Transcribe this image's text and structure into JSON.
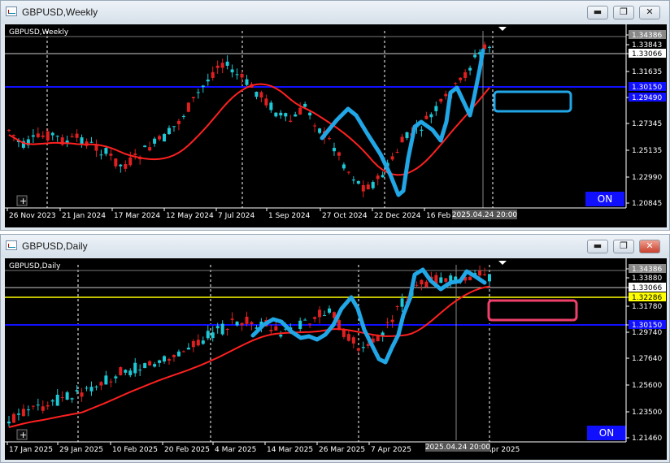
{
  "windows": [
    {
      "title": "GBPUSD,Weekly",
      "symbol_label": "GBPUSD,Weekly",
      "on_label": "ON",
      "cursor_time": "2025.04.24 20:00",
      "price_ticks": [
        "1.34386",
        "1.33843",
        "1.33066",
        "1.31635",
        "1.29490",
        "1.27345",
        "1.25135",
        "1.22990",
        "1.20845"
      ],
      "date_ticks": [
        "26 Nov 2023",
        "21 Jan 2024",
        "17 Mar 2024",
        "12 May 2024",
        "7 Jul 2024",
        "1 Sep 2024",
        "27 Oct 2024",
        "22 Dec 2024",
        "16 Feb"
      ],
      "hline_blue_label": "1.30150",
      "colors": {
        "bull": "#1ec8d6",
        "bear": "#e02020",
        "ma": "#ff2020",
        "blue_line": "#1010ff",
        "drawing": "#21a6e6",
        "box": "#21a6e6"
      }
    },
    {
      "title": "GBPUSD,Daily",
      "symbol_label": "GBPUSD,Daily",
      "on_label": "ON",
      "cursor_time": "2025.04.24 20:00",
      "price_ticks": [
        "1.34386",
        "1.33880",
        "1.33066",
        "1.32286",
        "1.31780",
        "1.30150",
        "1.29740",
        "1.27640",
        "1.25600",
        "1.23500",
        "1.21460"
      ],
      "date_ticks": [
        "17 Jan 2025",
        "29 Jan 2025",
        "10 Feb 2025",
        "20 Feb 2025",
        "4 Mar 2025",
        "14 Mar 2025",
        "26 Mar 2025",
        "7 Apr 2025",
        "Apr 2025"
      ],
      "colors": {
        "bull": "#1ec8d6",
        "bear": "#e02020",
        "ma": "#ff2020",
        "blue_line": "#1010ff",
        "yellow_line": "#ffff00",
        "drawing": "#21a6e6",
        "box": "#f0406a"
      }
    }
  ],
  "window_buttons": {
    "minimize": "▬",
    "restore": "❐",
    "close": "✕"
  }
}
